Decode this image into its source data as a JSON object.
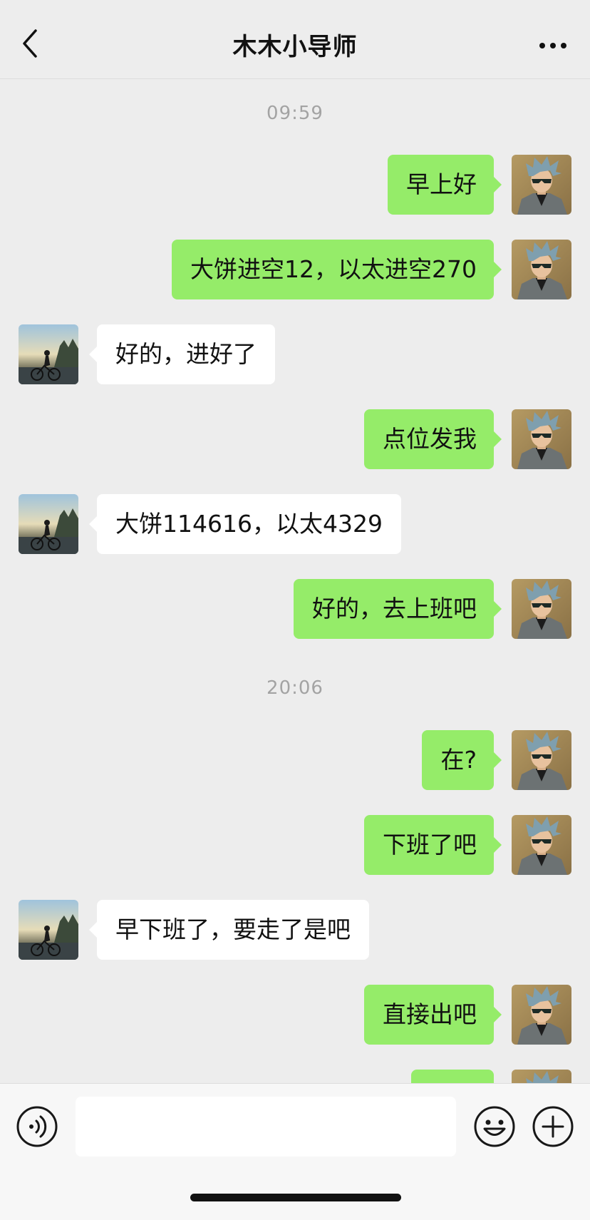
{
  "header": {
    "title": "木木小导师"
  },
  "chat": {
    "timestamps": [
      "09:59",
      "20:06"
    ],
    "messages": [
      {
        "from": "me",
        "text": "早上好"
      },
      {
        "from": "me",
        "text": "大饼进空12，以太进空270"
      },
      {
        "from": "them",
        "text": "好的，进好了"
      },
      {
        "from": "me",
        "text": "点位发我"
      },
      {
        "from": "them",
        "text": "大饼114616，以太4329"
      },
      {
        "from": "me",
        "text": "好的，去上班吧"
      },
      {
        "from": "me",
        "text": "在?"
      },
      {
        "from": "me",
        "text": "下班了吧"
      },
      {
        "from": "them",
        "text": "早下班了，要走了是吧"
      },
      {
        "from": "me",
        "text": "直接出吧"
      },
      {
        "from": "me",
        "text": ""
      }
    ]
  },
  "input": {
    "value": "",
    "placeholder": ""
  },
  "icons": {
    "back": "chevron-left-icon",
    "more": "more-dots-icon",
    "voice": "voice-icon",
    "emoji": "emoji-icon",
    "plus": "plus-icon"
  },
  "colors": {
    "my_bubble": "#95ec69",
    "their_bubble": "#ffffff",
    "background": "#ededed"
  }
}
